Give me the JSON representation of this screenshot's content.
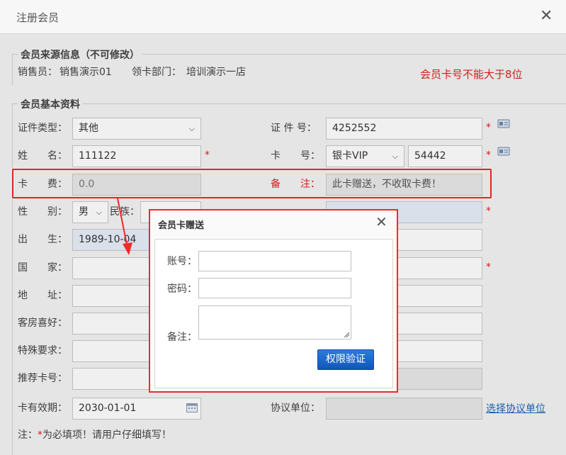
{
  "window": {
    "title": "注册会员",
    "close_glyph": "✕"
  },
  "source_section": {
    "legend": "会员来源信息（不可修改）",
    "salesperson_label": "销售员：",
    "salesperson_value": "销售演示01",
    "dept_label": "领卡部门：",
    "dept_value": "培训演示一店",
    "warning": "会员卡号不能大于8位"
  },
  "basic_section": {
    "legend": "会员基本资料",
    "id_type_label": "证件类型：",
    "id_type_value": "其他",
    "id_no_label": "证 件 号：",
    "id_no_value": "4252552",
    "name_label": "姓　　名：",
    "name_value": "111122",
    "card_no_label": "卡　　号：",
    "card_type_value": "银卡VIP",
    "card_no_value": "54442",
    "fee_label": "卡　　费：",
    "fee_value": "0.0",
    "remark_label": "备　　注：",
    "remark_value": "此卡赠送，不收取卡费！",
    "gender_label": "性　　别：",
    "gender_value": "男",
    "ethnicity_label": "民族：",
    "birth_label": "出　　生：",
    "birth_value": "1989-10-04",
    "country_label": "国　　家：",
    "address_label": "地　　址：",
    "room_pref_label": "客房喜好：",
    "special_label": "特殊要求：",
    "referral_label": "推荐卡号：",
    "validity_label": "卡有效期：",
    "validity_value": "2030-01-01",
    "agreement_label": "协议单位：",
    "agreement_link": "选择协议单位",
    "required_star": "*",
    "note_prefix": "注：",
    "note_star": "*",
    "note_text": "为必填项！请用户仔细填写！"
  },
  "modal": {
    "title": "会员卡赠送",
    "close_glyph": "✕",
    "account_label": "账号：",
    "password_label": "密码：",
    "remark_label": "备注：",
    "button": "权限验证"
  },
  "colors": {
    "accent_red": "#f02a2a",
    "link_blue": "#1e64b4",
    "button_blue": "#1a66c8"
  }
}
